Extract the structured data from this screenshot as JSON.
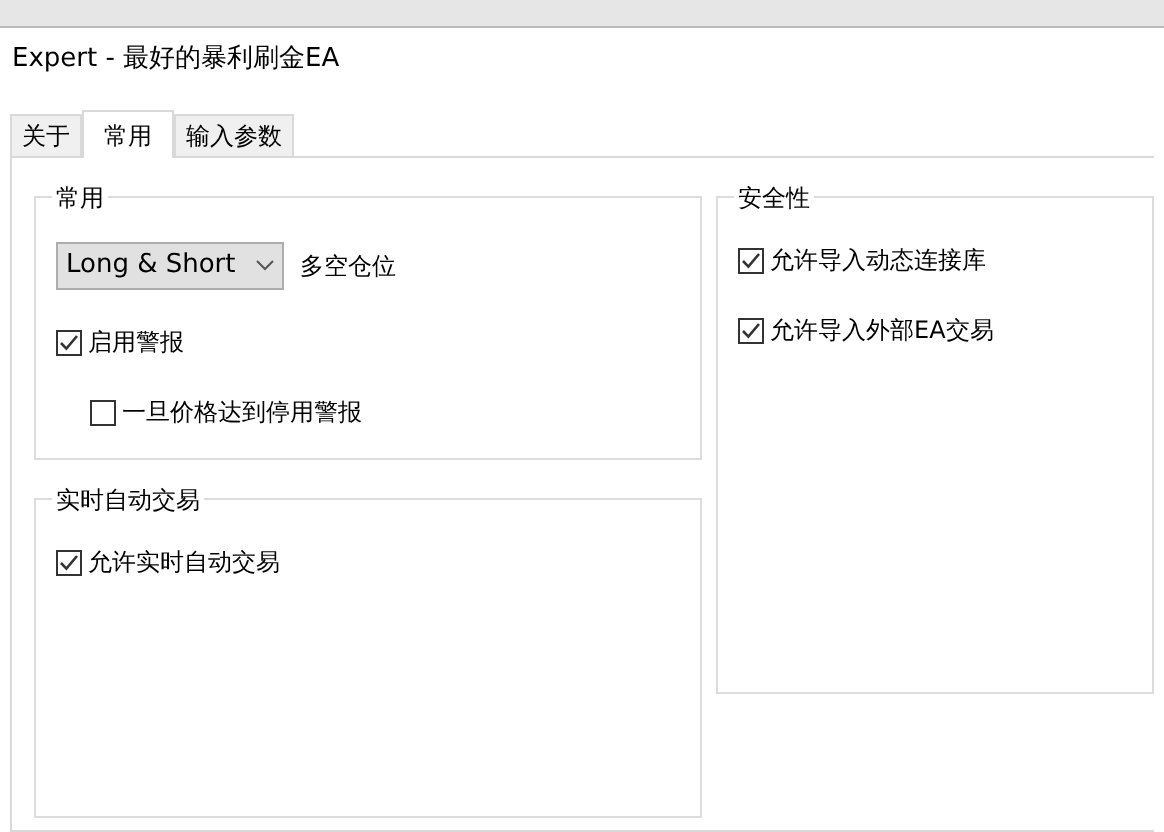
{
  "window": {
    "title": "Expert - 最好的暴利刷金EA"
  },
  "tabs": [
    {
      "label": "关于",
      "selected": false
    },
    {
      "label": "常用",
      "selected": true
    },
    {
      "label": "输入参数",
      "selected": false
    }
  ],
  "columns": [
    {
      "groups": [
        {
          "title": "常用",
          "items": [
            {
              "kind": "dropdown",
              "value": "Long & Short",
              "label": "多空仓位"
            },
            {
              "kind": "checkbox",
              "label": "启用警报",
              "checked": true,
              "children": [
                {
                  "kind": "checkbox",
                  "label": "一旦价格达到停用警报",
                  "checked": false
                }
              ]
            }
          ]
        },
        {
          "title": "实时自动交易",
          "items": [
            {
              "kind": "checkbox",
              "label": "允许实时自动交易",
              "checked": true
            }
          ]
        }
      ]
    },
    {
      "groups": [
        {
          "title": "安全性",
          "items": [
            {
              "kind": "checkbox",
              "label": "允许导入动态连接库",
              "checked": true
            },
            {
              "kind": "checkbox",
              "label": "允许导入外部EA交易",
              "checked": true
            }
          ]
        }
      ]
    }
  ]
}
